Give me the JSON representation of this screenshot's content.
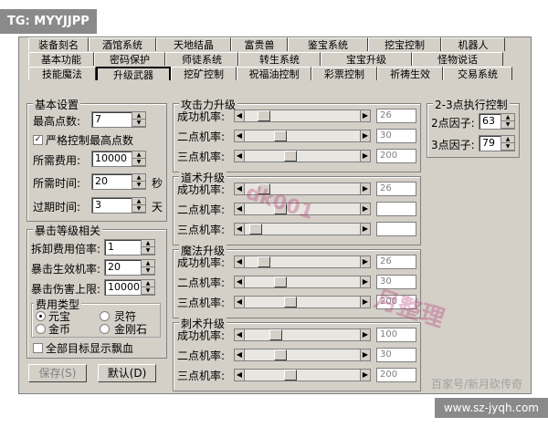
{
  "badge": "TG: MYYJJPP",
  "tabs_row1": [
    "装备刻名",
    "酒馆系统",
    "天地结晶",
    "富贵兽",
    "鉴宝系统",
    "挖宝控制",
    "机器人"
  ],
  "tabs_row2": [
    "基本功能",
    "密码保护",
    "师徒系统",
    "转生系统",
    "宝宝升级",
    "怪物说话"
  ],
  "tabs_row3": [
    "技能魔法",
    "升级武器",
    "挖矿控制",
    "祝福油控制",
    "彩票控制",
    "祈祷生效",
    "交易系统"
  ],
  "basic": {
    "title": "基本设置",
    "max_points_label": "最高点数:",
    "max_points": "7",
    "strict_label": "严格控制最高点数",
    "strict_checked": "✓",
    "fee_label": "所需费用:",
    "fee": "10000",
    "time_label": "所需时间:",
    "time": "20",
    "time_unit": "秒",
    "expire_label": "过期时间:",
    "expire": "3",
    "expire_unit": "天"
  },
  "crit": {
    "title": "暴击等级相关",
    "disassemble_label": "拆卸费用倍率:",
    "disassemble": "1",
    "chance_label": "暴击生效机率:",
    "chance": "20",
    "cap_label": "暴击伤害上限:",
    "cap": "10000",
    "fee_type_title": "费用类型",
    "opt_yuanbao": "元宝",
    "opt_lingfu": "灵符",
    "opt_jinbi": "金币",
    "opt_jingangshi": "金刚石",
    "show_all": "全部目标显示飘血"
  },
  "buttons": {
    "save": "保存(S)",
    "default": "默认(D)"
  },
  "attack": {
    "title": "攻击力升级",
    "rows": [
      {
        "label": "成功机率:",
        "value": "26",
        "level": 0.12
      },
      {
        "label": "二点机率:",
        "value": "30",
        "level": 0.28
      },
      {
        "label": "三点机率:",
        "value": "200",
        "level": 0.38
      }
    ]
  },
  "taoist": {
    "title": "道术升级",
    "rows": [
      {
        "label": "成功机率:",
        "value": "26",
        "level": 0.12
      },
      {
        "label": "二点机率:",
        "value": "",
        "level": 0.28
      },
      {
        "label": "三点机率:",
        "value": "",
        "level": 0.04
      }
    ]
  },
  "magic": {
    "title": "魔法升级",
    "rows": [
      {
        "label": "成功机率:",
        "value": "26",
        "level": 0.12
      },
      {
        "label": "二点机率:",
        "value": "30",
        "level": 0.28
      },
      {
        "label": "三点机率:",
        "value": "200",
        "level": 0.38
      }
    ]
  },
  "assassin": {
    "title": "刺术升级",
    "rows": [
      {
        "label": "成功机率:",
        "value": "100",
        "level": 0.24
      },
      {
        "label": "二点机率:",
        "value": "30",
        "level": 0.28
      },
      {
        "label": "三点机率:",
        "value": "200",
        "level": 0.38
      }
    ]
  },
  "exec": {
    "title": "2-3点执行控制",
    "f2_label": "2点因子:",
    "f2": "63",
    "f3_label": "3点因子:",
    "f3": "79"
  },
  "watermark": "dk001",
  "watermark2": "月整理",
  "footer_note": "百家号/新月砍传奇",
  "footer_url": "www.sz-jyqh.com"
}
